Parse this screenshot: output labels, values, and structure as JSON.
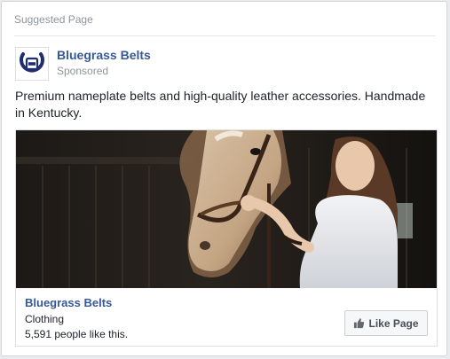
{
  "header": {
    "label": "Suggested Page"
  },
  "page": {
    "name": "Bluegrass Belts",
    "sponsored_label": "Sponsored"
  },
  "post": {
    "text": "Premium nameplate belts and high-quality leather accessories. Handmade in Kentucky."
  },
  "attachment": {
    "title": "Bluegrass Belts",
    "category": "Clothing",
    "likes_text": "5,591 people like this.",
    "like_button_label": "Like Page",
    "like_icon": "thumbs-up-icon"
  },
  "colors": {
    "link_blue": "#365899",
    "logo_navy": "#1f2f6e",
    "muted_gray": "#90949c",
    "body_text": "#1d2129"
  }
}
